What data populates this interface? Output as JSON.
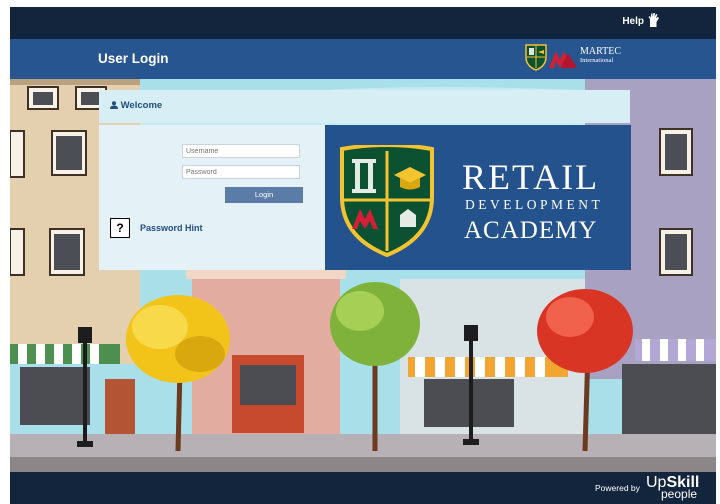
{
  "topbar": {
    "help_label": "Help"
  },
  "header": {
    "title": "User Login",
    "logo_main": "MARTEC",
    "logo_sub": "International"
  },
  "welcome": {
    "label": "Welcome"
  },
  "login": {
    "username_placeholder": "Username",
    "password_placeholder": "Password",
    "login_button": "Login",
    "hint_mark": "?",
    "password_hint": "Password Hint"
  },
  "banner": {
    "line1": "RETAIL",
    "line2": "DEVELOPMENT",
    "line3": "ACADEMY"
  },
  "footer": {
    "powered_by": "Powered by",
    "brand_up": "Up",
    "brand_skill": "Skill",
    "brand_people": "people"
  },
  "colors": {
    "navy": "#13243d",
    "title_blue": "#26558f",
    "banner_blue": "#24528c",
    "accent_red": "#d21f34",
    "gold": "#f4c430"
  }
}
